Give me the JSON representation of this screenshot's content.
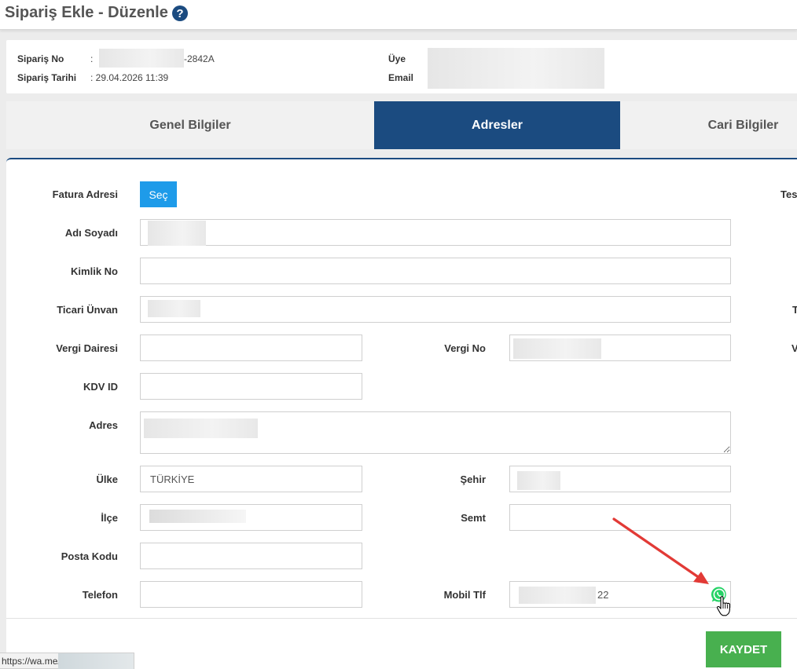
{
  "page": {
    "title": "Sipariş Ekle - Düzenle"
  },
  "info": {
    "order_no_label": "Sipariş No",
    "order_no_prefix": ": ",
    "order_no_suffix": "-2842A",
    "order_date_label": "Sipariş Tarihi",
    "order_date_value": ": 29.04.2026 11:39",
    "member_label": "Üye",
    "email_label": "Email"
  },
  "tabs": [
    {
      "label": "Genel Bilgiler",
      "active": false
    },
    {
      "label": "Adresler",
      "active": true
    },
    {
      "label": "Cari Bilgiler",
      "active": false
    }
  ],
  "form": {
    "billing_address_label": "Fatura Adresi",
    "select_button": "Seç",
    "full_name_label": "Adı Soyadı",
    "id_no_label": "Kimlik No",
    "trade_name_label": "Ticari Ünvan",
    "tax_office_label": "Vergi Dairesi",
    "tax_no_label": "Vergi No",
    "vat_id_label": "KDV ID",
    "address_label": "Adres",
    "country_label": "Ülke",
    "country_value": "TÜRKİYE",
    "city_label": "Şehir",
    "district_label": "İlçe",
    "neighborhood_label": "Semt",
    "postal_code_label": "Posta Kodu",
    "phone_label": "Telefon",
    "mobile_label": "Mobil Tlf",
    "mobile_value_suffix": "22"
  },
  "right_column": {
    "delivery_label_clipped": "Tes",
    "clipped_t": "T",
    "clipped_v": "V"
  },
  "actions": {
    "save_button": "KAYDET"
  },
  "status_bar": {
    "url_text": "https://wa.me/"
  },
  "colors": {
    "accent": "#1b4b80",
    "select_button": "#1e9be9",
    "save_button": "#48b04f",
    "whatsapp": "#25d366",
    "arrow": "#e23a36"
  }
}
